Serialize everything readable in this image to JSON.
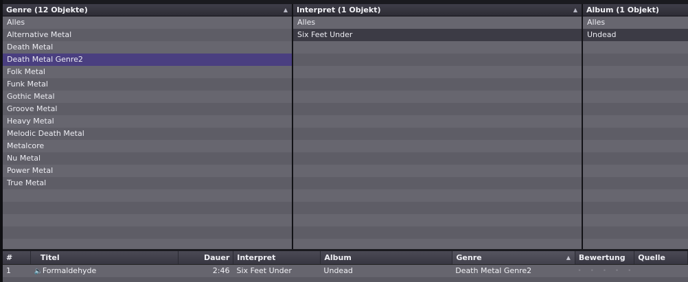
{
  "panes": {
    "genre": {
      "header": "Genre (12 Objekte)",
      "sort_icon": "sort-up-icon",
      "items": [
        "Alles",
        "Alternative Metal",
        "Death Metal",
        "Death Metal Genre2",
        "Folk Metal",
        "Funk Metal",
        "Gothic Metal",
        "Groove Metal",
        "Heavy Metal",
        "Melodic Death Metal",
        "Metalcore",
        "Nu Metal",
        "Power Metal",
        "True Metal"
      ],
      "selected": "Death Metal Genre2"
    },
    "interpret": {
      "header": "Interpret (1 Objekt)",
      "sort_icon": "sort-up-icon",
      "items": [
        "Alles",
        "Six Feet Under"
      ],
      "selected": "Six Feet Under"
    },
    "album": {
      "header": "Album (1 Objekt)",
      "items": [
        "Alles",
        "Undead"
      ],
      "selected": "Undead"
    }
  },
  "tracklist": {
    "columns": {
      "num": "#",
      "title": "Titel",
      "duration": "Dauer",
      "interpret": "Interpret",
      "album": "Album",
      "genre": "Genre",
      "rating": "Bewertung",
      "source": "Quelle"
    },
    "sorted_column": "genre",
    "rows": [
      {
        "num": "1",
        "title": "Formaldehyde",
        "duration": "2:46",
        "interpret": "Six Feet Under",
        "album": "Undead",
        "genre": "Death Metal Genre2",
        "rating": "• • • • •",
        "source": ""
      }
    ]
  },
  "colors": {
    "selection": "#4a3f80",
    "pane_bg": "#5e5d66",
    "header_bg": "#2d2c35"
  }
}
